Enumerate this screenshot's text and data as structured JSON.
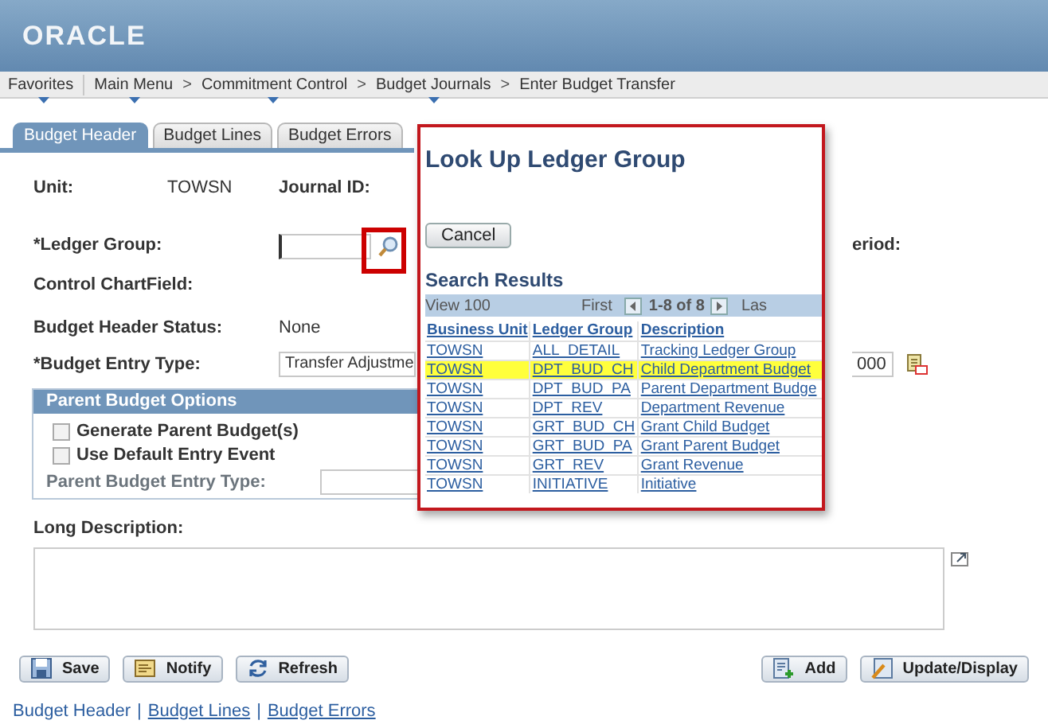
{
  "header": {
    "logo": "ORACLE"
  },
  "breadcrumbs": [
    {
      "label": "Favorites",
      "menu": true
    },
    {
      "label": "Main Menu",
      "menu": true
    },
    {
      "label": "Commitment Control",
      "prefix": ">",
      "menu": true
    },
    {
      "label": "Budget Journals",
      "prefix": ">",
      "menu": true
    },
    {
      "label": "Enter Budget Transfer",
      "prefix": ">",
      "menu": false
    }
  ],
  "tabs": [
    {
      "label": "Budget Header",
      "selected": true
    },
    {
      "label": "Budget Lines",
      "selected": false
    },
    {
      "label": "Budget Errors",
      "selected": false
    }
  ],
  "form": {
    "unit_label": "Unit:",
    "unit_value": "TOWSN",
    "journal_id_label": "Journal ID:",
    "ledger_group_label": "*Ledger Group:",
    "period_label": "eriod:",
    "control_chartfield_label": "Control ChartField:",
    "status_label": "Budget Header Status:",
    "status_value": "None",
    "entry_type_label": "*Budget Entry Type:",
    "entry_type_value": "Transfer Adjustme",
    "right_field_value": "000"
  },
  "parent_options": {
    "title": "Parent Budget Options",
    "checkboxes": [
      {
        "label": "Generate Parent Budget(s)",
        "checked": false
      },
      {
        "label": "Use Default Entry Event",
        "checked": false
      }
    ],
    "entry_type_label": "Parent Budget Entry Type:"
  },
  "long_description": {
    "label": "Long Description:"
  },
  "buttons_left": [
    {
      "label": "Save",
      "kind": "save"
    },
    {
      "label": "Notify",
      "kind": "notify"
    },
    {
      "label": "Refresh",
      "kind": "refresh"
    }
  ],
  "buttons_right": [
    {
      "label": "Add",
      "kind": "add"
    },
    {
      "label": "Update/Display",
      "kind": "update"
    }
  ],
  "footer_links": [
    {
      "label": "Budget Header",
      "link": false
    },
    {
      "label": "Budget Lines",
      "separator": "|",
      "link": true
    },
    {
      "label": "Budget Errors",
      "separator": "|",
      "link": true
    }
  ],
  "lookup": {
    "title": "Look Up Ledger Group",
    "cancel": "Cancel",
    "results_title": "Search Results",
    "view": "View 100",
    "first": "First",
    "range": "1-8 of 8",
    "last": "Las",
    "columns": [
      "Business Unit",
      "Ledger Group",
      "Description"
    ],
    "rows": [
      {
        "cells": [
          "TOWSN",
          "ALL_DETAIL",
          "Tracking Ledger Group"
        ],
        "selected": false
      },
      {
        "cells": [
          "TOWSN",
          "DPT_BUD_CH",
          "Child Department Budget"
        ],
        "selected": true
      },
      {
        "cells": [
          "TOWSN",
          "DPT_BUD_PA",
          "Parent Department Budge"
        ],
        "selected": false
      },
      {
        "cells": [
          "TOWSN",
          "DPT_REV",
          "Department Revenue"
        ],
        "selected": false
      },
      {
        "cells": [
          "TOWSN",
          "GRT_BUD_CH",
          "Grant Child Budget"
        ],
        "selected": false
      },
      {
        "cells": [
          "TOWSN",
          "GRT_BUD_PA",
          "Grant Parent Budget"
        ],
        "selected": false
      },
      {
        "cells": [
          "TOWSN",
          "GRT_REV",
          "Grant Revenue"
        ],
        "selected": false
      },
      {
        "cells": [
          "TOWSN",
          "INITIATIVE",
          "Initiative"
        ],
        "selected": false
      }
    ]
  }
}
